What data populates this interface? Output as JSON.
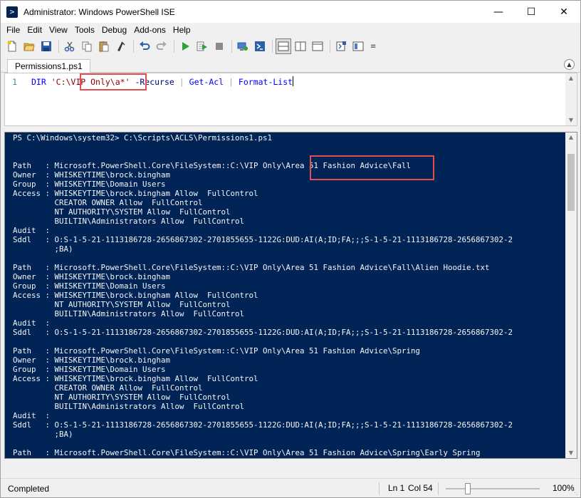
{
  "window": {
    "title": "Administrator: Windows PowerShell ISE"
  },
  "menu": [
    "File",
    "Edit",
    "View",
    "Tools",
    "Debug",
    "Add-ons",
    "Help"
  ],
  "toolbar": {
    "icons": [
      "new-file-icon",
      "open-folder-icon",
      "save-icon",
      "cut-icon",
      "copy-icon",
      "paste-icon",
      "clear-console-icon",
      "undo-icon",
      "redo-icon",
      "run-script-icon",
      "run-selection-icon",
      "stop-icon",
      "new-remote-tab-icon",
      "start-powershell-icon",
      "show-script-top-icon",
      "show-script-right-icon",
      "show-script-maximized-icon",
      "show-command-icon",
      "show-addon-icon"
    ]
  },
  "tab": {
    "label": "Permissions1.ps1"
  },
  "script": {
    "line_number": "1",
    "tokens": {
      "cmd1": "DIR",
      "str": "'C:\\VIP Only\\a*'",
      "param": "-Recurse",
      "pipe1": "|",
      "cmd2": "Get-Acl",
      "pipe2": "|",
      "cmd3": "Format-List"
    }
  },
  "console": {
    "lines": [
      "PS C:\\Windows\\system32> C:\\Scripts\\ACLS\\Permissions1.ps1",
      "",
      "",
      "Path   : Microsoft.PowerShell.Core\\FileSystem::C:\\VIP Only\\Area 51 Fashion Advice\\Fall",
      "Owner  : WHISKEYTIME\\brock.bingham",
      "Group  : WHISKEYTIME\\Domain Users",
      "Access : WHISKEYTIME\\brock.bingham Allow  FullControl",
      "         CREATOR OWNER Allow  FullControl",
      "         NT AUTHORITY\\SYSTEM Allow  FullControl",
      "         BUILTIN\\Administrators Allow  FullControl",
      "Audit  :",
      "Sddl   : O:S-1-5-21-1113186728-2656867302-2701855655-1122G:DUD:AI(A;ID;FA;;;S-1-5-21-1113186728-2656867302-2",
      "         ;BA)",
      "",
      "Path   : Microsoft.PowerShell.Core\\FileSystem::C:\\VIP Only\\Area 51 Fashion Advice\\Fall\\Alien Hoodie.txt",
      "Owner  : WHISKEYTIME\\brock.bingham",
      "Group  : WHISKEYTIME\\Domain Users",
      "Access : WHISKEYTIME\\brock.bingham Allow  FullControl",
      "         NT AUTHORITY\\SYSTEM Allow  FullControl",
      "         BUILTIN\\Administrators Allow  FullControl",
      "Audit  :",
      "Sddl   : O:S-1-5-21-1113186728-2656867302-2701855655-1122G:DUD:AI(A;ID;FA;;;S-1-5-21-1113186728-2656867302-2",
      "",
      "Path   : Microsoft.PowerShell.Core\\FileSystem::C:\\VIP Only\\Area 51 Fashion Advice\\Spring",
      "Owner  : WHISKEYTIME\\brock.bingham",
      "Group  : WHISKEYTIME\\Domain Users",
      "Access : WHISKEYTIME\\brock.bingham Allow  FullControl",
      "         CREATOR OWNER Allow  FullControl",
      "         NT AUTHORITY\\SYSTEM Allow  FullControl",
      "         BUILTIN\\Administrators Allow  FullControl",
      "Audit  :",
      "Sddl   : O:S-1-5-21-1113186728-2656867302-2701855655-1122G:DUD:AI(A;ID;FA;;;S-1-5-21-1113186728-2656867302-2",
      "         ;BA)",
      "",
      "Path   : Microsoft.PowerShell.Core\\FileSystem::C:\\VIP Only\\Area 51 Fashion Advice\\Spring\\Early Spring"
    ]
  },
  "status": {
    "text": "Completed",
    "ln": "Ln 1",
    "col": "Col 54",
    "zoom": "100%",
    "zoom_level_fraction": 0.22
  },
  "colors": {
    "console_bg": "#012456",
    "console_fg": "#f5f5f5",
    "highlight": "#e84c4c"
  }
}
